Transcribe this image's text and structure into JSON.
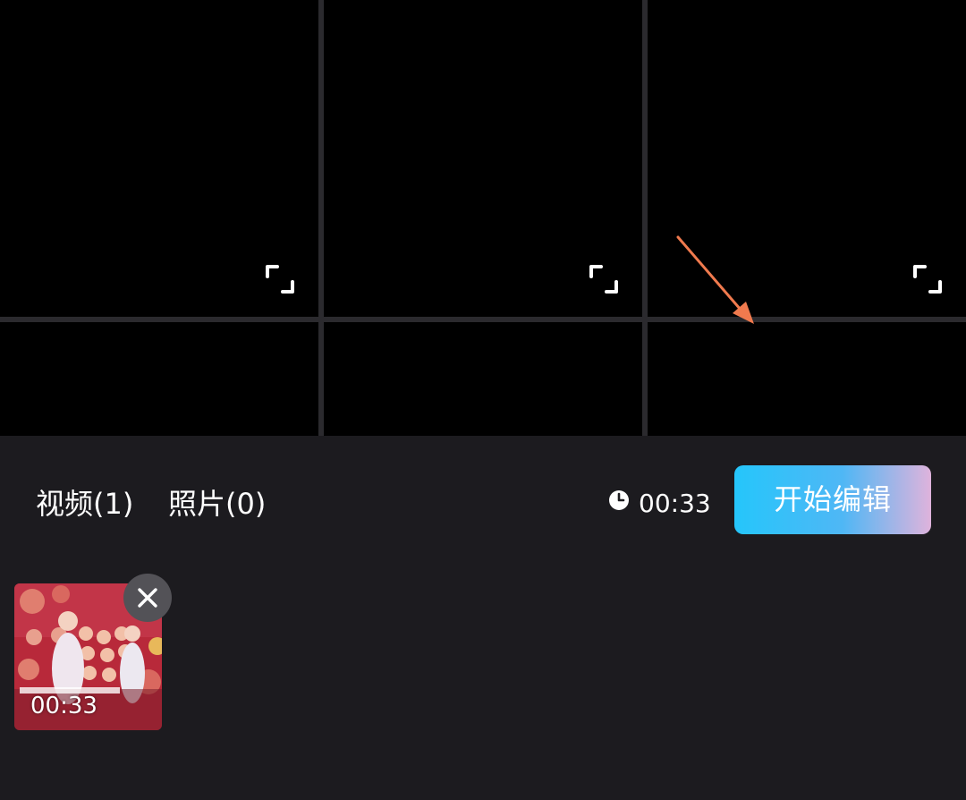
{
  "media_tabs": [
    {
      "label": "视频(1)"
    },
    {
      "label": "照片(0)"
    }
  ],
  "selection": {
    "total_duration": "00:33",
    "clock_icon": "clock-icon"
  },
  "start_edit_button": {
    "label": "开始编辑"
  },
  "selected_clips": [
    {
      "duration": "00:33",
      "remove_icon": "close-icon"
    }
  ],
  "preview_grid": {
    "expand_icon": "expand-icon"
  },
  "colors": {
    "background": "#1c1b1f",
    "grid_line": "#2b2a2e",
    "button_gradient_start": "#25c6fb",
    "button_gradient_end": "#dfb3dc",
    "annotation_arrow": "#f07a4e"
  }
}
